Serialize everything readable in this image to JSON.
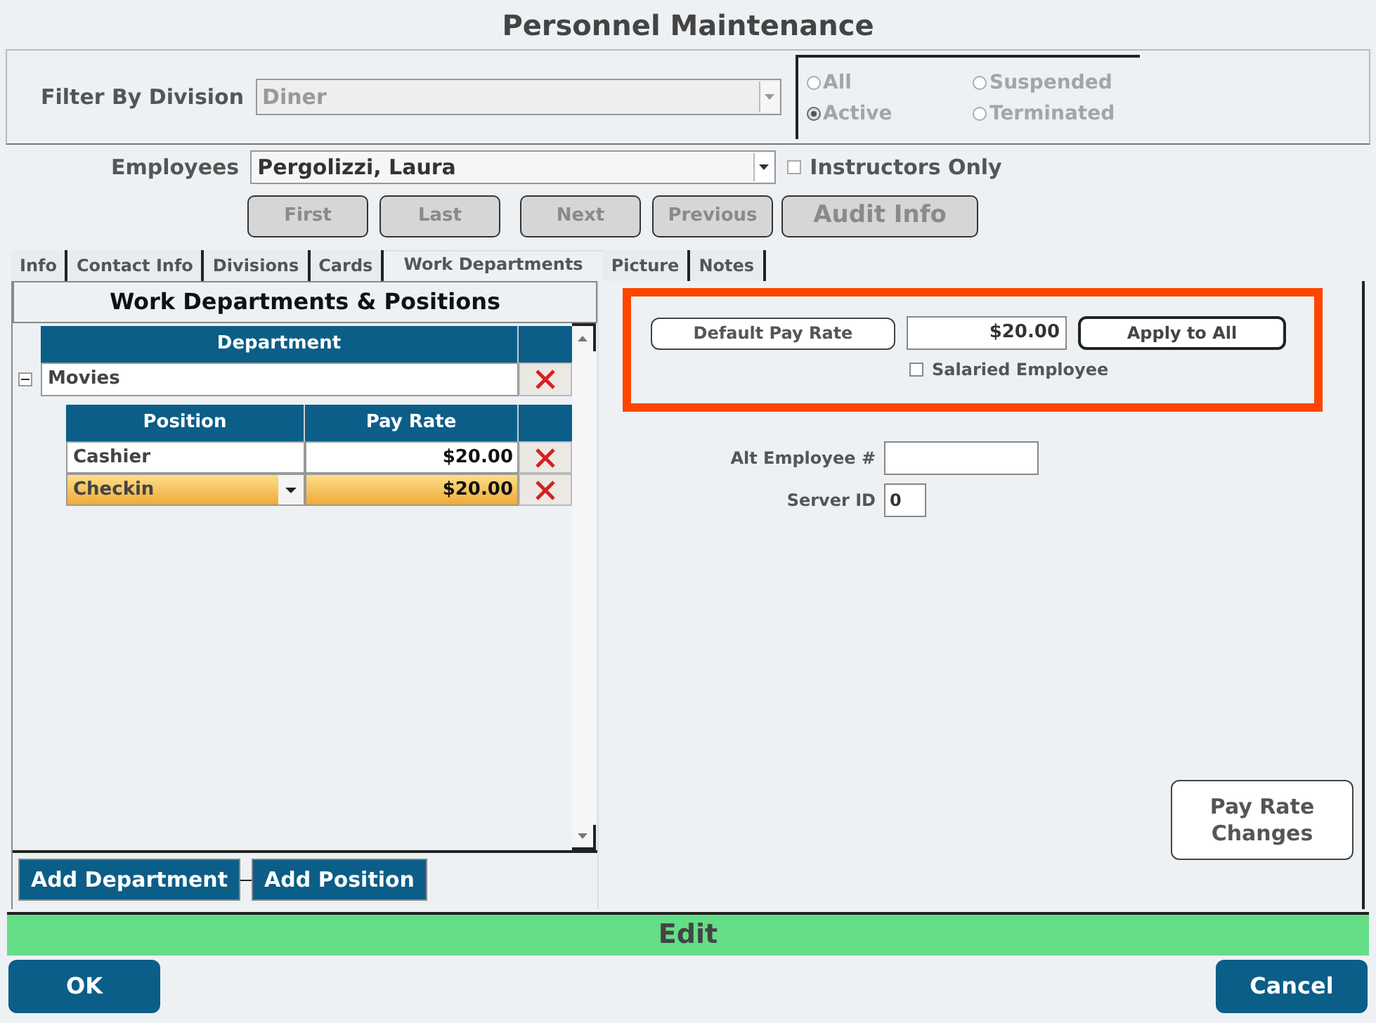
{
  "window": {
    "title": "Personnel Maintenance"
  },
  "filter": {
    "label": "Filter By Division",
    "value": "Diner",
    "disabled": true
  },
  "status_filter": [
    {
      "label": "All",
      "selected": false
    },
    {
      "label": "Suspended",
      "selected": false
    },
    {
      "label": "Active",
      "selected": true
    },
    {
      "label": "Terminated",
      "selected": false
    }
  ],
  "employees": {
    "label": "Employees",
    "value": "Pergolizzi, Laura"
  },
  "instructors_only": {
    "label": "Instructors Only",
    "checked": false
  },
  "nav_buttons": [
    {
      "label": "First",
      "kind": "nav",
      "disabled": true
    },
    {
      "label": "Last",
      "kind": "nav",
      "disabled": true
    },
    {
      "label": "Next",
      "kind": "nav",
      "disabled": true
    },
    {
      "label": "Previous",
      "kind": "nav",
      "disabled": true
    },
    {
      "label": "Audit Info",
      "kind": "large",
      "disabled": true
    }
  ],
  "tabs": [
    {
      "label": "Info",
      "selected": false
    },
    {
      "label": "Contact Info",
      "selected": false
    },
    {
      "label": "Divisions",
      "selected": false
    },
    {
      "label": "Cards",
      "selected": false
    },
    {
      "label": "Work Departments",
      "selected": true
    },
    {
      "label": "Picture",
      "selected": false
    },
    {
      "label": "Notes",
      "selected": false
    }
  ],
  "departments_panel": {
    "title": "Work Departments & Positions",
    "columns": [
      "Department"
    ],
    "departments": [
      {
        "name": "Movies",
        "expanded": true,
        "position_columns": [
          "Position",
          "Pay Rate"
        ],
        "positions": [
          {
            "name": "Cashier",
            "pay_rate": "$20.00",
            "selected": false
          },
          {
            "name": "Checkin",
            "pay_rate": "$20.00",
            "selected": true
          }
        ]
      }
    ],
    "buttons": [
      "Add Department",
      "Add Position"
    ]
  },
  "pay_settings": {
    "default_pay_rate_button": "Default Pay Rate",
    "default_pay_rate": "$20.00",
    "apply_button": "Apply to All",
    "salaried": {
      "label": "Salaried Employee",
      "checked": false
    }
  },
  "fields": [
    {
      "label": "Alt Employee #"
    },
    {
      "label": "Server ID",
      "value": "0"
    }
  ],
  "pay_rate_changes_button": "Pay Rate Changes",
  "mode": "Edit",
  "footer_buttons": [
    "OK",
    "Cancel"
  ]
}
